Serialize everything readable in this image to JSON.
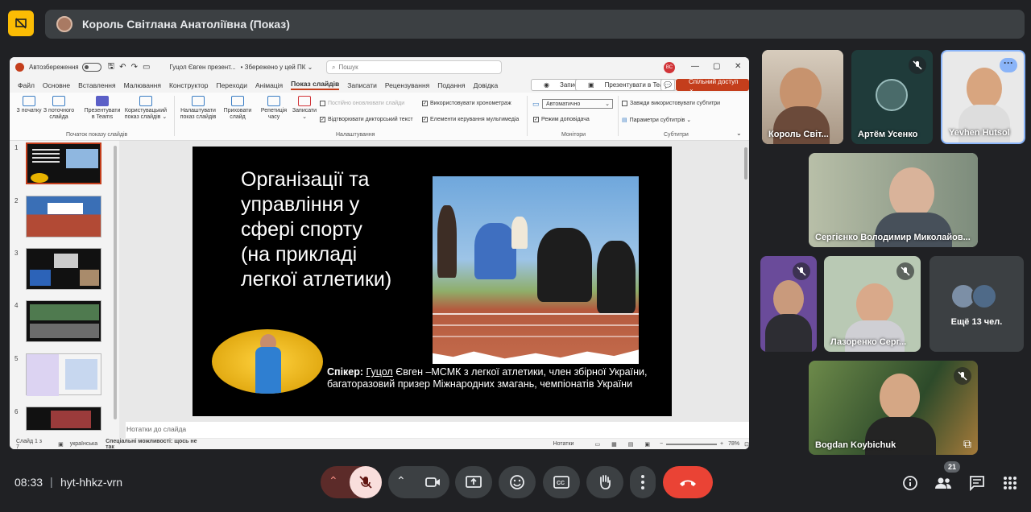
{
  "top": {
    "presenter_name": "Король Світлана Анатоліївна (Показ)"
  },
  "ppt": {
    "autosave_label": "Автозбереження",
    "file_title": "Гуцол Євген презент...",
    "saved_state": "• Збережено у цей ПК ⌄",
    "search_placeholder": "Пошук",
    "user_initials": "ВС",
    "menu": [
      "Файл",
      "Основне",
      "Вставлення",
      "Малювання",
      "Конструктор",
      "Переходи",
      "Анімація",
      "Показ слайдів",
      "Записати",
      "Рецензування",
      "Подання",
      "Довідка"
    ],
    "record_btn": "Записати",
    "present_teams_btn": "Презентувати в Teams",
    "share_btn": "Спільний доступ ⌄",
    "ribbon": {
      "from_start": "З початку",
      "from_current": "З поточного слайда",
      "present_teams": "Презентувати в Teams",
      "custom_show": "Користувацький показ слайдів ⌄",
      "group_start": "Початок показу слайдів",
      "setup_show": "Налаштувати показ слайдів",
      "hide_slide": "Приховати слайд",
      "rehearse": "Репетиція часу",
      "record": "Записати ⌄",
      "chk_update": "Постійно оновлювати слайди",
      "chk_narration": "Відтворювати дикторський текст",
      "chk_timings": "Використовувати хронометраж",
      "chk_media": "Елементи керування мультимедіа",
      "group_setup": "Налаштування",
      "monitor_auto": "Автоматично",
      "presenter_view": "Режим доповідача",
      "group_monitors": "Монітори",
      "always_subs": "Завжди використовувати субтитри",
      "subs_params": "Параметри субтитрів ⌄",
      "group_subs": "Субтитри"
    },
    "thumb_numbers": [
      "1",
      "2",
      "3",
      "4",
      "5",
      "6"
    ],
    "slide": {
      "title_lines": [
        "Організації та",
        "управління у",
        "сфері спорту",
        "(на прикладі",
        "легкої атлетики)"
      ],
      "speaker_label": "Спікер:",
      "speaker_name": "Гуцол",
      "speaker_text": " Євген –МСМК з легкої атлетики, член збірної України, багаторазовий призер Міжнародних змагань, чемпіонатів України"
    },
    "notes_placeholder": "Нотатки до слайда",
    "status": {
      "slide_of": "Слайд 1 з 7",
      "language": "українська",
      "accessibility": "Спеціальні можливості: щось не так",
      "notes": "Нотатки",
      "zoom": "78%"
    }
  },
  "participants": [
    {
      "name": "Король Світ..."
    },
    {
      "name": "Артём Усенко"
    },
    {
      "name": "Yevhen Hutsol"
    },
    {
      "name": "Сергієнко Володимир Миколайов..."
    },
    {
      "name": ""
    },
    {
      "name": "Лазоренко Серг..."
    },
    {
      "name": "Ещё 13 чел."
    },
    {
      "name": "Bogdan Koybichuk"
    }
  ],
  "bottom": {
    "time": "08:33",
    "separator": "|",
    "meeting_code": "hyt-hhkz-vrn",
    "people_count": "21"
  },
  "icons": {
    "present": "presentation-icon",
    "mic": "mic-off-icon",
    "camera": "camera-icon",
    "share": "present-screen-icon",
    "emoji": "emoji-icon",
    "captions": "captions-icon",
    "hand": "raise-hand-icon",
    "more": "more-vert-icon",
    "hangup": "hangup-icon",
    "info": "info-icon",
    "people": "people-icon",
    "chat": "chat-icon",
    "activities": "grid-icon"
  },
  "colors": {
    "hangup": "#ea4335",
    "accent": "#8ab4f8",
    "ppt_accent": "#c43e1c"
  }
}
